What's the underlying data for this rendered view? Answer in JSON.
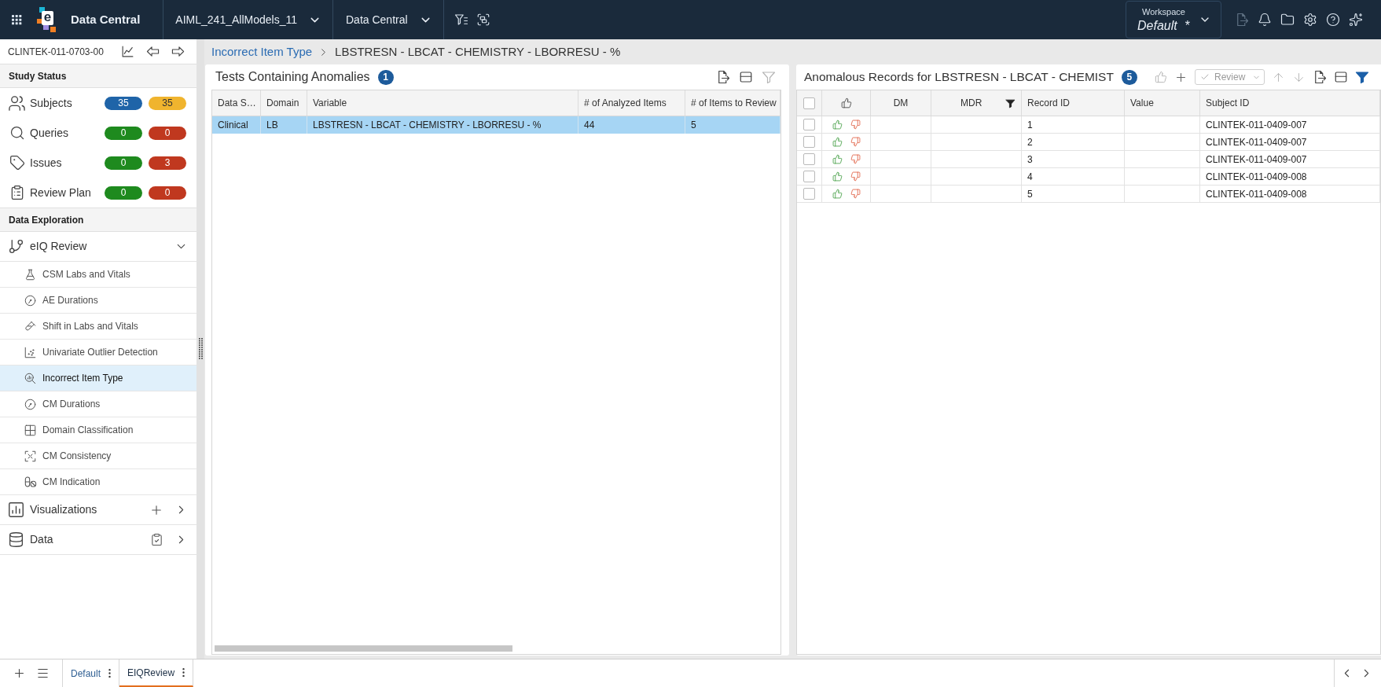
{
  "top_bar": {
    "logo_letter": "e",
    "app_title": "Data Central",
    "study": "AIML_241_AllModels_11",
    "module": "Data Central",
    "workspace": {
      "label": "Workspace",
      "value": "Default",
      "unsaved_mark": "*"
    }
  },
  "sidebar": {
    "study_id": "CLINTEK-011-0703-00",
    "study_status": {
      "title": "Study Status",
      "items": [
        {
          "label": "Subjects",
          "counts": [
            {
              "value": "35",
              "color": "#1f64a8"
            },
            {
              "value": "35",
              "color": "#f0b42e"
            }
          ]
        },
        {
          "label": "Queries",
          "counts": [
            {
              "value": "0",
              "color": "#1e8a1e"
            },
            {
              "value": "0",
              "color": "#c0381f"
            }
          ]
        },
        {
          "label": "Issues",
          "counts": [
            {
              "value": "0",
              "color": "#1e8a1e"
            },
            {
              "value": "3",
              "color": "#c0381f"
            }
          ]
        },
        {
          "label": "Review Plan",
          "counts": [
            {
              "value": "0",
              "color": "#1e8a1e"
            },
            {
              "value": "0",
              "color": "#c0381f"
            }
          ]
        }
      ]
    },
    "data_exploration": {
      "title": "Data Exploration",
      "items": [
        {
          "label": "eIQ Review",
          "expanded": true,
          "children": [
            {
              "label": "CSM Labs and Vitals",
              "selected": false
            },
            {
              "label": "AE Durations",
              "selected": false
            },
            {
              "label": "Shift in Labs and Vitals",
              "selected": false
            },
            {
              "label": "Univariate Outlier Detection",
              "selected": false
            },
            {
              "label": "Incorrect Item Type",
              "selected": true
            },
            {
              "label": "CM Durations",
              "selected": false
            },
            {
              "label": "Domain Classification",
              "selected": false
            },
            {
              "label": "CM Consistency",
              "selected": false
            },
            {
              "label": "CM Indication",
              "selected": false
            }
          ]
        },
        {
          "label": "Visualizations",
          "expanded": false
        },
        {
          "label": "Data",
          "expanded": false
        }
      ]
    }
  },
  "breadcrumb": {
    "parent": "Incorrect Item Type",
    "current": "LBSTRESN - LBCAT - CHEMISTRY - LBORRESU - %"
  },
  "tests_panel": {
    "title": "Tests Containing Anomalies",
    "count": "1",
    "columns": [
      "Data S…",
      "Domain",
      "Variable",
      "# of Analyzed Items",
      "# of Items to Review"
    ],
    "rows": [
      {
        "selected": true,
        "cells": [
          "Clinical",
          "LB",
          "LBSTRESN - LBCAT - CHEMISTRY - LBORRESU - %",
          "44",
          "5"
        ]
      }
    ]
  },
  "records_panel": {
    "title": "Anomalous Records for LBSTRESN - LBCAT - CHEMIST",
    "count": "5",
    "review_menu": {
      "label": "Review",
      "disabled": true
    },
    "select_all": {
      "checked": false
    },
    "columns": [
      {
        "label": "DM",
        "filtered": false
      },
      {
        "label": "MDR",
        "filtered": true
      },
      {
        "label": "Record ID",
        "filtered": false
      },
      {
        "label": "Value",
        "filtered": false
      },
      {
        "label": "Subject ID",
        "filtered": false
      }
    ],
    "rows": [
      {
        "checked": false,
        "record_id": "1",
        "subject_id": "CLINTEK-011-0409-007"
      },
      {
        "checked": false,
        "record_id": "2",
        "subject_id": "CLINTEK-011-0409-007"
      },
      {
        "checked": false,
        "record_id": "3",
        "subject_id": "CLINTEK-011-0409-007"
      },
      {
        "checked": false,
        "record_id": "4",
        "subject_id": "CLINTEK-011-0409-008"
      },
      {
        "checked": false,
        "record_id": "5",
        "subject_id": "CLINTEK-011-0409-008"
      }
    ]
  },
  "bottom_tabs": [
    {
      "label": "Default",
      "selected": false
    },
    {
      "label": "EIQReview",
      "selected": true
    }
  ]
}
